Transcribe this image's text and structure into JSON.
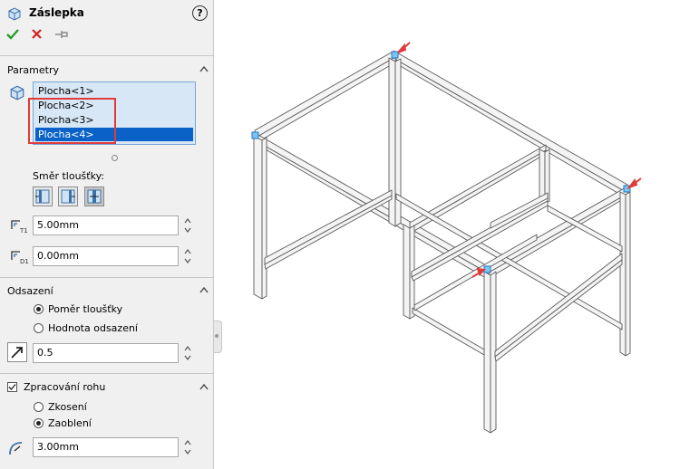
{
  "feature": {
    "title": "Záslepka"
  },
  "icons": {
    "title": "box-icon",
    "help": "help-icon",
    "ok": "checkmark-icon",
    "cancel": "cross-icon",
    "pin": "pushpin-icon",
    "collapse": "chevron-up-icon",
    "selection": "box-icon",
    "thickness": "thickness-icon",
    "depth": "depth-icon",
    "offset_value": "offset-arrow-icon",
    "fillet_radius": "radius-icon"
  },
  "colors": {
    "accent": "#0a62c8",
    "highlight": "#e03a3a",
    "ok": "#2a9d2a",
    "cancel": "#d42020"
  },
  "parameters": {
    "heading": "Parametry",
    "faces": [
      "Plocha<1>",
      "Plocha<2>",
      "Plocha<3>",
      "Plocha<4>"
    ],
    "selected_face": "Plocha<4>",
    "direction_label": "Směr tloušťky:",
    "direction_buttons": [
      "thickness-outside-icon",
      "thickness-inside-icon",
      "thickness-both-icon"
    ],
    "thickness_value": "5.00mm",
    "depth_value": "0.00mm"
  },
  "offset": {
    "heading": "Odsazení",
    "option_ratio": "Poměr tloušťky",
    "option_value": "Hodnota odsazení",
    "selected": "Poměr tloušťky",
    "value": "0.5"
  },
  "corner": {
    "heading": "Zpracování rohu",
    "checked": true,
    "option_chamfer": "Zkosení",
    "option_fillet": "Zaoblení",
    "selected": "Zaoblení",
    "radius_value": "3.00mm"
  }
}
